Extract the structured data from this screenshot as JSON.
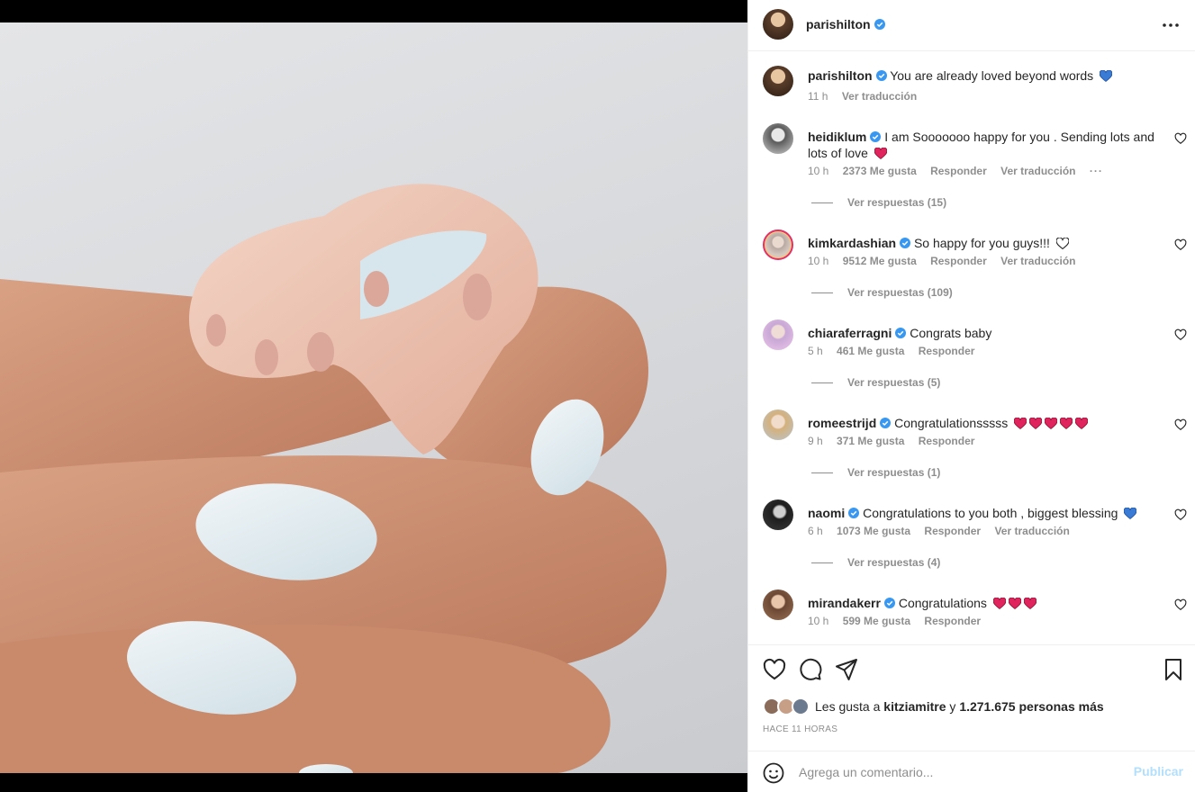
{
  "post": {
    "author": "parishilton",
    "colors": {
      "verified": "#3897f0",
      "link_muted": "#b2dffc",
      "heart_red": "#ed4956",
      "heart_blue": "#3a7bd5"
    }
  },
  "caption": {
    "user": "parishilton",
    "text": "You are already loved beyond words",
    "emoji": "blue-heart",
    "time": "11 h",
    "translate": "Ver traducción"
  },
  "comments": [
    {
      "user": "heidiklum",
      "text": "I am Sooooooo happy for you . Sending lots and lots of love",
      "emoji": [
        "red-heart"
      ],
      "time": "10 h",
      "likes": "2373 Me gusta",
      "reply": "Responder",
      "translate": "Ver traducción",
      "replies": "Ver respuestas (15)"
    },
    {
      "user": "kimkardashian",
      "text": "So happy for you guys!!!",
      "emoji": [
        "white-heart"
      ],
      "time": "10 h",
      "likes": "9512 Me gusta",
      "reply": "Responder",
      "translate": "Ver traducción",
      "replies": "Ver respuestas (109)"
    },
    {
      "user": "chiaraferragni",
      "text": "Congrats baby",
      "emoji": [],
      "time": "5 h",
      "likes": "461 Me gusta",
      "reply": "Responder",
      "translate": "",
      "replies": "Ver respuestas (5)"
    },
    {
      "user": "romeestrijd",
      "text": "Congratulationsssss",
      "emoji": [
        "red-heart",
        "red-heart",
        "red-heart",
        "red-heart",
        "red-heart"
      ],
      "time": "9 h",
      "likes": "371 Me gusta",
      "reply": "Responder",
      "translate": "",
      "replies": "Ver respuestas (1)"
    },
    {
      "user": "naomi",
      "text": "Congratulations to you both , biggest blessing",
      "emoji": [
        "blue-heart"
      ],
      "time": "6 h",
      "likes": "1073 Me gusta",
      "reply": "Responder",
      "translate": "Ver traducción",
      "replies": "Ver respuestas (4)"
    },
    {
      "user": "mirandakerr",
      "text": "Congratulations",
      "emoji": [
        "red-heart",
        "red-heart",
        "red-heart"
      ],
      "time": "10 h",
      "likes": "599 Me gusta",
      "reply": "Responder",
      "translate": "",
      "replies": ""
    }
  ],
  "likes": {
    "prefix": "Les gusta a",
    "user": "kitziamitre",
    "conj": "y",
    "others": "1.271.675 personas más"
  },
  "timestamp": "HACE 11 HORAS",
  "add_comment": {
    "placeholder": "Agrega un comentario...",
    "publish": "Publicar"
  }
}
